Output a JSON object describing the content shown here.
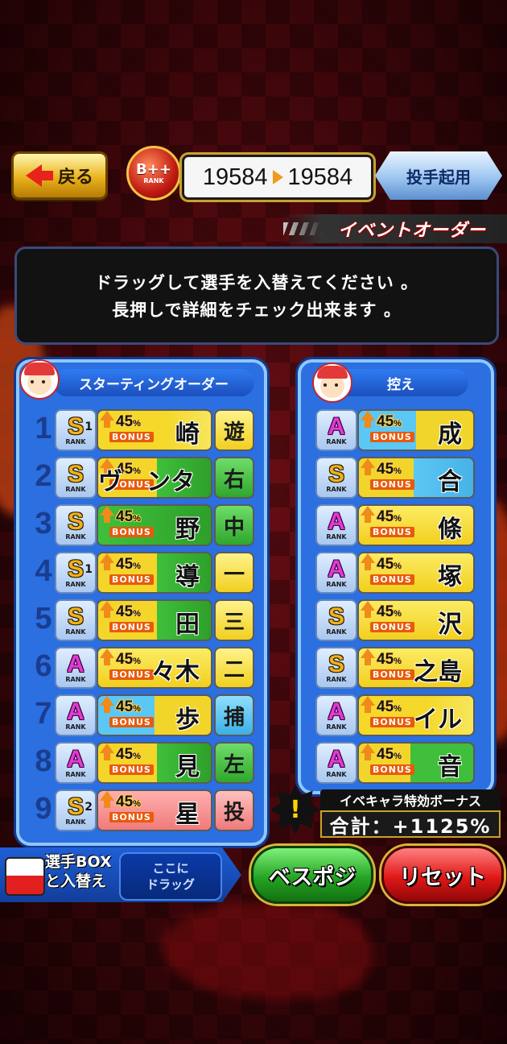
{
  "header": {
    "back_label": "戻る",
    "rank_badge": "B++",
    "rank_badge_sub": "RANK",
    "score_before": "19584",
    "score_after": "19584",
    "pitcher_button": "投手起用"
  },
  "event_banner": "イベントオーダー",
  "instruction": {
    "line1": "ドラッグして選手を入替えてください 。",
    "line2": "長押しで詳細をチェック出来ます 。"
  },
  "starting": {
    "title": "スターティングオーダー",
    "rows": [
      {
        "order": "1",
        "rank": "S",
        "rank_sub": "1",
        "rank_label": "RANK",
        "bonus": "45",
        "bonus_word": "BONUS",
        "name": "崎",
        "position": "遊"
      },
      {
        "order": "2",
        "rank": "S",
        "rank_sub": "",
        "rank_label": "RANK",
        "bonus": "45",
        "bonus_word": "BONUS",
        "name": "ヴ　ンター",
        "position": "右"
      },
      {
        "order": "3",
        "rank": "S",
        "rank_sub": "",
        "rank_label": "RANK",
        "bonus": "45",
        "bonus_word": "BONUS",
        "name": "野",
        "position": "中"
      },
      {
        "order": "4",
        "rank": "S",
        "rank_sub": "1",
        "rank_label": "RANK",
        "bonus": "45",
        "bonus_word": "BONUS",
        "name": "導",
        "position": "一"
      },
      {
        "order": "5",
        "rank": "S",
        "rank_sub": "",
        "rank_label": "RANK",
        "bonus": "45",
        "bonus_word": "BONUS",
        "name": "田",
        "position": "三"
      },
      {
        "order": "6",
        "rank": "A",
        "rank_sub": "",
        "rank_label": "RANK",
        "bonus": "45",
        "bonus_word": "BONUS",
        "name": "々木",
        "position": "二"
      },
      {
        "order": "7",
        "rank": "A",
        "rank_sub": "",
        "rank_label": "RANK",
        "bonus": "45",
        "bonus_word": "BONUS",
        "name": "歩",
        "position": "捕"
      },
      {
        "order": "8",
        "rank": "A",
        "rank_sub": "",
        "rank_label": "RANK",
        "bonus": "45",
        "bonus_word": "BONUS",
        "name": "見",
        "position": "左"
      },
      {
        "order": "9",
        "rank": "S",
        "rank_sub": "2",
        "rank_label": "RANK",
        "bonus": "45",
        "bonus_word": "BONUS",
        "name": "星",
        "position": "投"
      }
    ]
  },
  "bench": {
    "title": "控え",
    "rows": [
      {
        "rank": "A",
        "rank_sub": "",
        "rank_label": "RANK",
        "bonus": "45",
        "bonus_word": "BONUS",
        "name": "成"
      },
      {
        "rank": "S",
        "rank_sub": "",
        "rank_label": "RANK",
        "bonus": "45",
        "bonus_word": "BONUS",
        "name": "合"
      },
      {
        "rank": "A",
        "rank_sub": "",
        "rank_label": "RANK",
        "bonus": "45",
        "bonus_word": "BONUS",
        "name": "條"
      },
      {
        "rank": "A",
        "rank_sub": "",
        "rank_label": "RANK",
        "bonus": "45",
        "bonus_word": "BONUS",
        "name": "塚"
      },
      {
        "rank": "S",
        "rank_sub": "",
        "rank_label": "RANK",
        "bonus": "45",
        "bonus_word": "BONUS",
        "name": "沢"
      },
      {
        "rank": "S",
        "rank_sub": "",
        "rank_label": "RANK",
        "bonus": "45",
        "bonus_word": "BONUS",
        "name": "之島"
      },
      {
        "rank": "A",
        "rank_sub": "",
        "rank_label": "RANK",
        "bonus": "45",
        "bonus_word": "BONUS",
        "name": "イル"
      },
      {
        "rank": "A",
        "rank_sub": "",
        "rank_label": "RANK",
        "bonus": "45",
        "bonus_word": "BONUS",
        "name": "音"
      }
    ]
  },
  "bonus_summary": {
    "title": "イベキャラ特効ボーナス",
    "total": "合計：+1125%",
    "icon": "!"
  },
  "footer": {
    "box_label_line1": "選手BOX",
    "box_label_line2": "と入替え",
    "drop_line1": "ここに",
    "drop_line2": "ドラッグ",
    "best_label": "ベスポジ",
    "reset_label": "リセット"
  },
  "colors": {
    "background": "#3a060a",
    "panel_blue": "#2b6fe0",
    "rank_s": "#f0b21a",
    "rank_a": "#e23ad6",
    "bonus_orange": "#e85a0c"
  }
}
